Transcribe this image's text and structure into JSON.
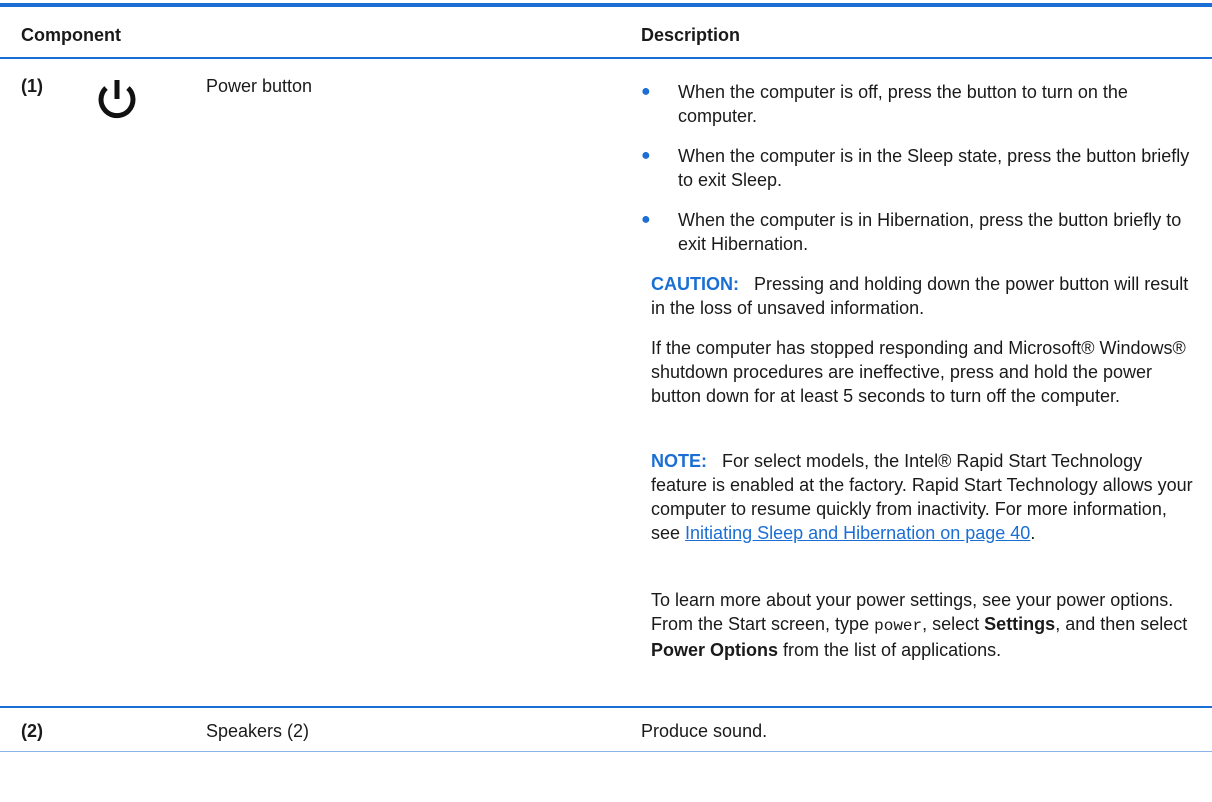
{
  "table": {
    "header": {
      "component": "Component",
      "description": "Description"
    },
    "rows": [
      {
        "num": "(1)",
        "icon": "power-icon",
        "name": "Power button",
        "bullets": [
          "When the computer is off, press the button to turn on the computer.",
          "When the computer is in the Sleep state, press the button briefly to exit Sleep.",
          "When the computer is in Hibernation, press the button briefly to exit Hibernation."
        ],
        "caution": {
          "label": "CAUTION:",
          "text": "Pressing and holding down the power button will result in the loss of unsaved information."
        },
        "para1": "If the computer has stopped responding and Microsoft® Windows® shutdown procedures are ineffective, press and hold the power button down for at least 5 seconds to turn off the computer.",
        "note": {
          "label": "NOTE:",
          "text": "For select models, the Intel® Rapid Start Technology feature is enabled at the factory. Rapid Start Technology allows your computer to resume quickly from inactivity. For more information, see",
          "link": "Initiating Sleep and Hibernation on page 40",
          "end": "."
        },
        "para2": {
          "t1": "To learn more about your power settings, see your power options. From the Start screen, type",
          "code": "power",
          "t2": ", select",
          "b1": "Settings",
          "t3": ", and then select",
          "b2": "Power Options",
          "t4": "from the list of applications."
        }
      },
      {
        "num": "(2)",
        "name": "Speakers (2)",
        "description": "Produce sound."
      }
    ]
  },
  "colors": {
    "accent": "#1b6ed3"
  }
}
